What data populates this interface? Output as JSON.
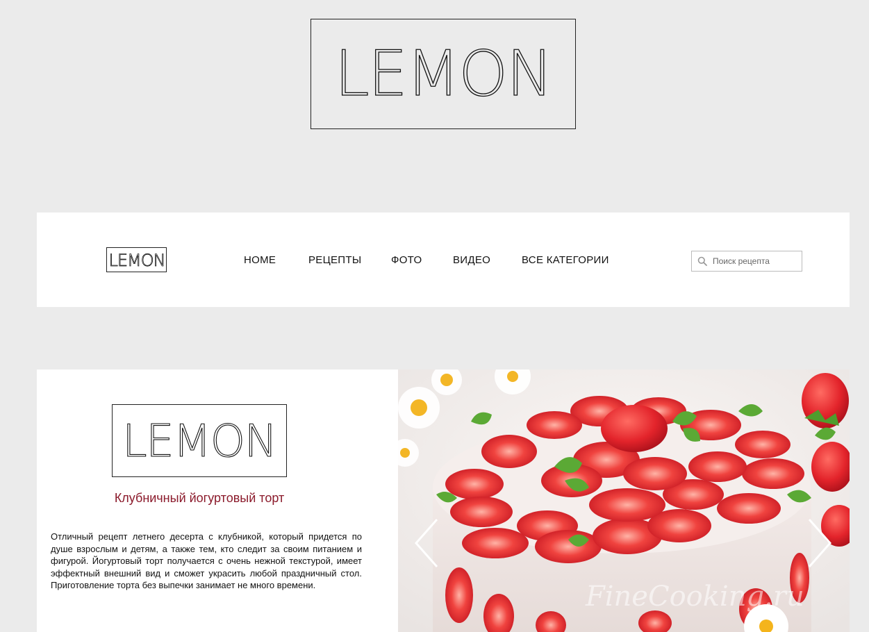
{
  "brand": {
    "logo_text": "LEMON"
  },
  "nav": {
    "items": [
      {
        "label": "HOME"
      },
      {
        "label": "РЕЦЕПТЫ"
      },
      {
        "label": "ФОТО"
      },
      {
        "label": "ВИДЕО"
      },
      {
        "label": "ВСЕ КАТЕГОРИИ"
      }
    ]
  },
  "search": {
    "placeholder": "Поиск рецепта",
    "value": ""
  },
  "featured": {
    "title": "Клубничный йогуртовый торт",
    "description": "Отличный рецепт летнего десерта с клубникой, который придется по душе взрослым и детям, а также тем, кто следит за своим питанием и фигурой. Йогуртовый торт получается с очень нежной текстурой, имеет эффектный внешний вид и сможет украсить любой праздничный стол. Приготовление торта без выпечки занимает не много времени.",
    "watermark": "FineCooking.ru"
  },
  "colors": {
    "page_bg": "#ebebeb",
    "panel_bg": "#ffffff",
    "title_accent": "#8b1a2b",
    "strawberry": "#e0242b",
    "cream": "#f4ecea"
  },
  "icons": {
    "search": "search-icon",
    "prev": "chevron-left-icon",
    "next": "chevron-right-icon"
  }
}
